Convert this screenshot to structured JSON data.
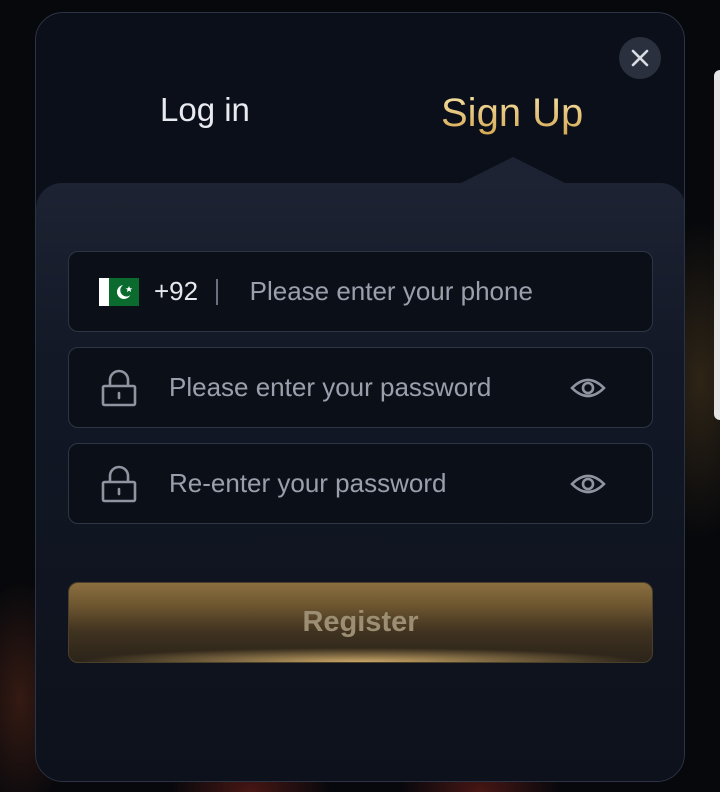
{
  "tabs": {
    "login": "Log in",
    "signup": "Sign Up"
  },
  "phone": {
    "country_code": "+92",
    "flag": "pakistan-flag",
    "placeholder": "Please enter your phone"
  },
  "password": {
    "placeholder": "Please enter your password"
  },
  "confirm_password": {
    "placeholder": "Re-enter your password"
  },
  "register_label": "Register",
  "colors": {
    "accent_gold": "#d4a752",
    "background": "#0b0f19",
    "field_border": "#2e3545"
  },
  "icons": [
    "close-icon",
    "pakistan-flag-icon",
    "lock-icon",
    "eye-icon"
  ]
}
